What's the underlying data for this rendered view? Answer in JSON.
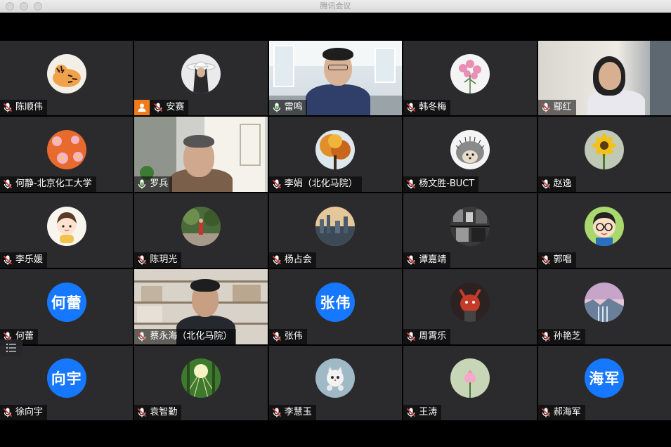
{
  "window": {
    "title": "腾讯会议"
  },
  "participants": [
    {
      "name": "陈顺伟",
      "avatar": "tiger",
      "mic": "muted"
    },
    {
      "name": "安赛",
      "avatar": "girl-hat",
      "mic": "muted",
      "badge": "person-icon"
    },
    {
      "name": "雷鸣",
      "avatar": "video-room",
      "mic": "active"
    },
    {
      "name": "韩冬梅",
      "avatar": "pink-flowers",
      "mic": "muted"
    },
    {
      "name": "鄢红",
      "avatar": "video-woman",
      "mic": "muted"
    },
    {
      "name": "何静-北京化工大学",
      "avatar": "flowers-orange",
      "mic": "muted"
    },
    {
      "name": "罗兵",
      "avatar": "video-man-window",
      "mic": "active",
      "speaking": true
    },
    {
      "name": "李娟（北化马院）",
      "avatar": "autumn-tree",
      "mic": "muted"
    },
    {
      "name": "杨文胜-BUCT",
      "avatar": "hedgehog",
      "mic": "muted"
    },
    {
      "name": "赵逸",
      "avatar": "sunflower",
      "mic": "muted"
    },
    {
      "name": "李乐媛",
      "avatar": "cartoon-girl",
      "mic": "muted"
    },
    {
      "name": "陈玥光",
      "avatar": "garden-girl",
      "mic": "muted"
    },
    {
      "name": "杨占会",
      "avatar": "city-sunset",
      "mic": "muted"
    },
    {
      "name": "谭嘉靖",
      "avatar": "bw-photo",
      "mic": "muted"
    },
    {
      "name": "郭唱",
      "avatar": "cartoon-glasses",
      "mic": "muted"
    },
    {
      "name": "何蕾",
      "avatar_text": "何蕾",
      "mic": "muted"
    },
    {
      "name": "蔡永海（北化马院）",
      "avatar": "video-bookshelf",
      "mic": "muted"
    },
    {
      "name": "张伟",
      "avatar_text": "张伟",
      "mic": "muted"
    },
    {
      "name": "周霄乐",
      "avatar": "red-creature",
      "mic": "muted"
    },
    {
      "name": "孙艳芝",
      "avatar": "landscape-purple",
      "mic": "muted"
    },
    {
      "name": "徐向宇",
      "avatar_text": "向宇",
      "mic": "muted"
    },
    {
      "name": "袁智勤",
      "avatar": "sunlit-forest",
      "mic": "muted"
    },
    {
      "name": "李慧玉",
      "avatar": "cat-toy",
      "mic": "muted"
    },
    {
      "name": "王涛",
      "avatar": "lotus",
      "mic": "muted"
    },
    {
      "name": "郝海军",
      "avatar_text": "海军",
      "mic": "muted"
    }
  ],
  "colors": {
    "avatar_blue": "#1677ff",
    "speaking_border": "#4cd137",
    "tile_bg": "#2b2b2e",
    "muted_mic": "#e04040"
  }
}
